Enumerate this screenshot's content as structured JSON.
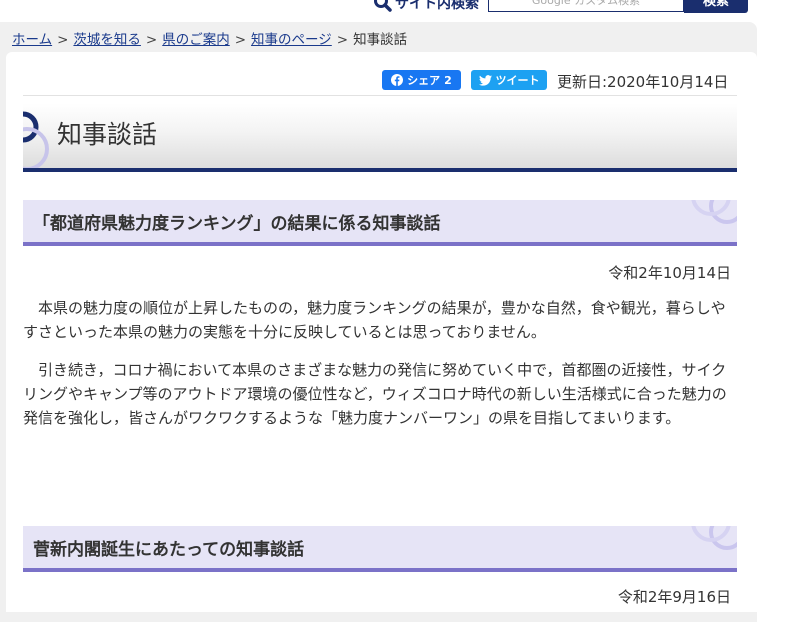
{
  "header": {
    "site_search_label": "サイト内検索",
    "search_placeholder": "Google カスタム検索",
    "search_button": "検索"
  },
  "breadcrumb": {
    "items": [
      "ホーム",
      "茨城を知る",
      "県のご案内",
      "知事のページ"
    ],
    "current": "知事談話",
    "separator": ">"
  },
  "share": {
    "facebook_label": "シェア",
    "facebook_count": "2",
    "twitter_label": "ツイート"
  },
  "updated": "更新日:2020年10月14日",
  "page_title": "知事談話",
  "sections": [
    {
      "title": "「都道府県魅力度ランキング」の結果に係る知事談話",
      "date": "令和2年10月14日",
      "paragraphs": [
        "本県の魅力度の順位が上昇したものの，魅力度ランキングの結果が，豊かな自然，食や観光，暮らしやすさといった本県の魅力の実態を十分に反映しているとは思っておりません。",
        "引き続き，コロナ禍において本県のさまざまな魅力の発信に努めていく中で，首都圏の近接性，サイクリングやキャンプ等のアウトドア環境の優位性など，ウィズコロナ時代の新しい生活様式に合った魅力の発信を強化し，皆さんがワクワクするような「魅力度ナンバーワン」の県を目指してまいります。"
      ]
    },
    {
      "title": "菅新内閣誕生にあたっての知事談話",
      "date": "令和2年9月16日"
    }
  ],
  "colors": {
    "navy": "#1a2e6e",
    "section_bg": "#e6e4f6",
    "section_rule": "#7b72c8",
    "facebook": "#1877f2",
    "twitter": "#1da1f2"
  }
}
